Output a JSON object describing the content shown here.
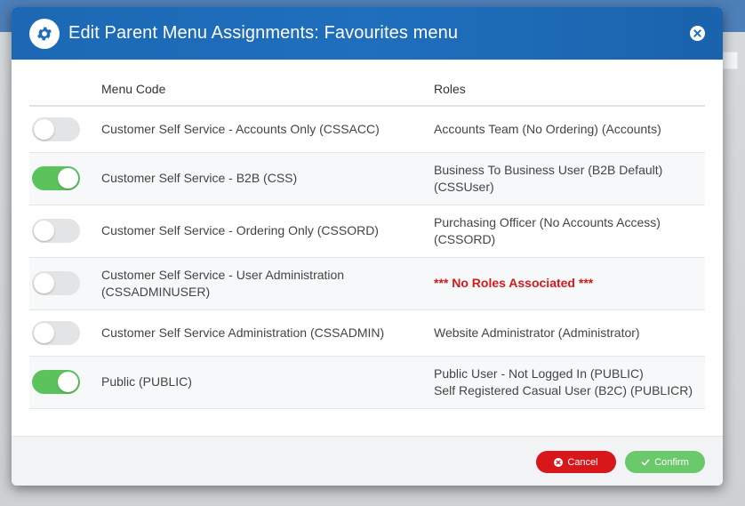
{
  "dialog": {
    "title": "Edit Parent Menu Assignments: Favourites menu",
    "icon": "gear-icon",
    "close_icon": "close-icon"
  },
  "table": {
    "headers": {
      "menu_code": "Menu Code",
      "roles": "Roles"
    },
    "rows": [
      {
        "enabled": false,
        "menu_code": "Customer Self Service - Accounts Only (CSSACC)",
        "roles": [
          "Accounts Team (No Ordering) (Accounts)"
        ]
      },
      {
        "enabled": true,
        "menu_code": "Customer Self Service - B2B (CSS)",
        "roles": [
          "Business To Business User (B2B Default)",
          "(CSSUser)"
        ]
      },
      {
        "enabled": false,
        "menu_code": "Customer Self Service - Ordering Only (CSSORD)",
        "roles": [
          "Purchasing Officer (No Accounts Access)",
          "(CSSORD)"
        ]
      },
      {
        "enabled": false,
        "menu_code_lines": [
          "Customer Self Service - User Administration",
          "(CSSADMINUSER)"
        ],
        "no_roles_text": "*** No Roles Associated ***"
      },
      {
        "enabled": false,
        "menu_code": "Customer Self Service Administration (CSSADMIN)",
        "roles": [
          "Website Administrator (Administrator)"
        ]
      },
      {
        "enabled": true,
        "menu_code": "Public (PUBLIC)",
        "roles": [
          "Public User - Not Logged In (PUBLIC)",
          "Self Registered Casual User (B2C) (PUBLICR)"
        ]
      }
    ]
  },
  "footer": {
    "cancel_label": "Cancel",
    "confirm_label": "Confirm"
  },
  "colors": {
    "header_blue": "#1f6fbd",
    "toggle_on": "#5cc35c",
    "toggle_off": "#e3e4e5",
    "cancel_red": "#d8171b",
    "confirm_green": "#6ac96a",
    "no_roles_red": "#d51a1a"
  }
}
